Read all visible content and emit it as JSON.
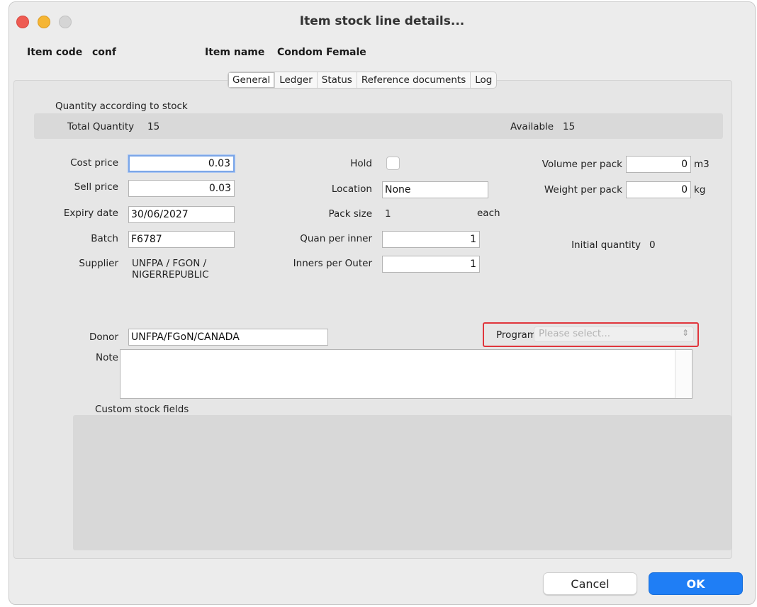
{
  "window": {
    "title": "Item stock line details..."
  },
  "header": {
    "item_code_label": "Item code",
    "item_code_value": "conf",
    "item_name_label": "Item name",
    "item_name_value": "Condom Female"
  },
  "tabs": [
    {
      "label": "General",
      "active": true
    },
    {
      "label": "Ledger",
      "active": false
    },
    {
      "label": "Status",
      "active": false
    },
    {
      "label": "Reference documents",
      "active": false
    },
    {
      "label": "Log",
      "active": false
    }
  ],
  "quantity": {
    "section_title": "Quantity according to stock",
    "total_label": "Total Quantity",
    "total_value": "15",
    "available_label": "Available",
    "available_value": "15"
  },
  "fields": {
    "cost_price": {
      "label": "Cost price",
      "value": "0.03"
    },
    "sell_price": {
      "label": "Sell price",
      "value": "0.03"
    },
    "expiry_date": {
      "label": "Expiry date",
      "value": "30/06/2027"
    },
    "batch": {
      "label": "Batch",
      "value": "F6787"
    },
    "supplier": {
      "label": "Supplier",
      "line1": "UNFPA / FGON /",
      "line2": "NIGERREPUBLIC"
    },
    "hold": {
      "label": "Hold",
      "checked": false
    },
    "location": {
      "label": "Location",
      "value": "None"
    },
    "pack_size": {
      "label": "Pack size",
      "value": "1",
      "unit": "each"
    },
    "quan_per_inner": {
      "label": "Quan per inner",
      "value": "1"
    },
    "inners_per_outer": {
      "label": "Inners per Outer",
      "value": "1"
    },
    "volume_per_pack": {
      "label": "Volume per pack",
      "value": "0",
      "unit": "m3"
    },
    "weight_per_pack": {
      "label": "Weight per pack",
      "value": "0",
      "unit": "kg"
    },
    "initial_quantity": {
      "label": "Initial quantity",
      "value": "0"
    },
    "donor": {
      "label": "Donor",
      "value": "UNFPA/FGoN/CANADA"
    },
    "program": {
      "label": "Program",
      "placeholder": "Please select..."
    },
    "note": {
      "label": "Note",
      "value": ""
    }
  },
  "custom_fields": {
    "title": "Custom stock fields"
  },
  "buttons": {
    "cancel": "Cancel",
    "ok": "OK"
  },
  "colors": {
    "accent": "#1f7ef5",
    "highlight": "#e0353c",
    "close": "#ee5b52",
    "minimize": "#f5b533"
  }
}
